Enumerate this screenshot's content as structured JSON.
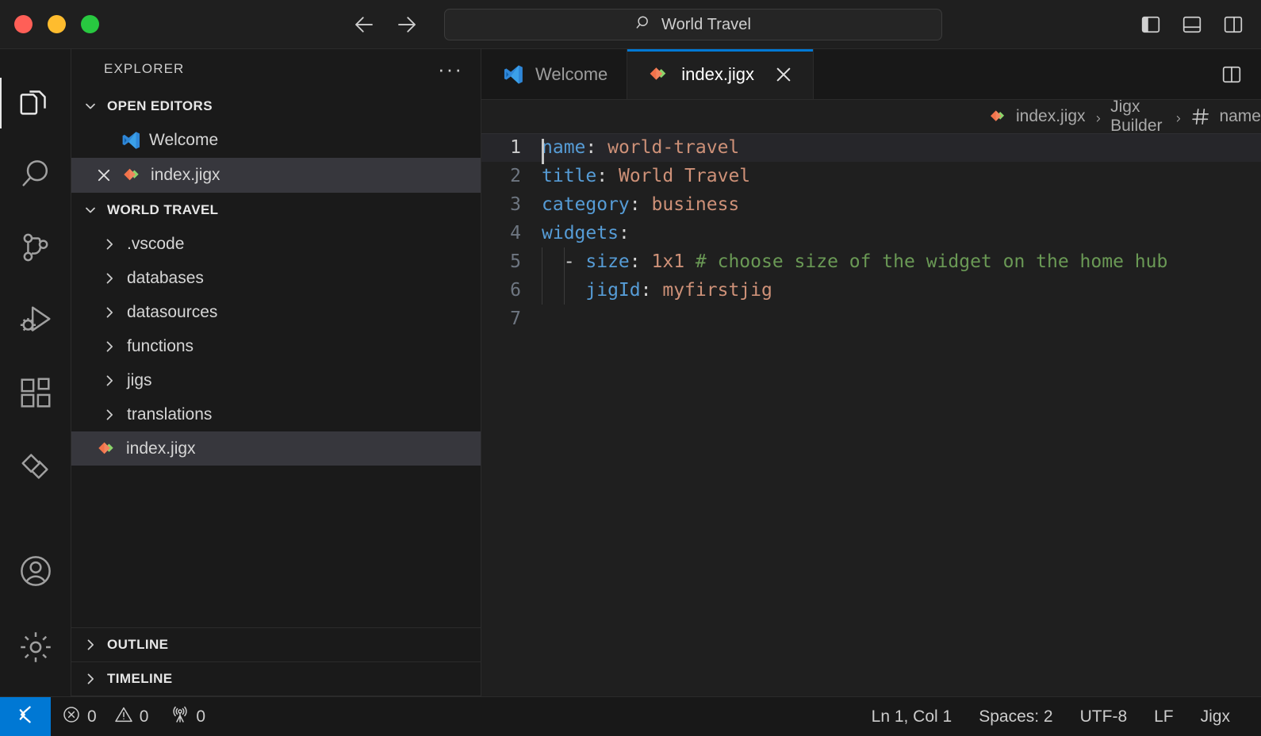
{
  "window": {
    "traffic_lights": [
      "close",
      "minimize",
      "maximize"
    ],
    "accent_blue": "#0078d4",
    "command_center": {
      "text": "World Travel",
      "icon": "search-icon"
    },
    "nav": {
      "back": "back-arrow-icon",
      "forward": "forward-arrow-icon"
    },
    "layout_toggles": [
      {
        "name": "toggle-primary-sidebar",
        "state": "on"
      },
      {
        "name": "toggle-panel",
        "state": "off"
      },
      {
        "name": "toggle-secondary-sidebar",
        "state": "off"
      }
    ]
  },
  "activity_bar": {
    "items": [
      {
        "name": "explorer",
        "icon": "files-icon",
        "active": true
      },
      {
        "name": "search",
        "icon": "search-icon",
        "active": false
      },
      {
        "name": "source-control",
        "icon": "source-control-icon",
        "active": false
      },
      {
        "name": "run-and-debug",
        "icon": "run-debug-icon",
        "active": false
      },
      {
        "name": "extensions",
        "icon": "extensions-icon",
        "active": false
      },
      {
        "name": "jigx",
        "icon": "jigx-diamond-icon",
        "active": false
      }
    ],
    "bottom_items": [
      {
        "name": "accounts",
        "icon": "account-icon"
      },
      {
        "name": "manage-settings",
        "icon": "gear-icon"
      }
    ]
  },
  "sidebar": {
    "title": "EXPLORER",
    "more_actions": "···",
    "open_editors": {
      "label": "OPEN EDITORS",
      "expanded": true,
      "items": [
        {
          "label": "Welcome",
          "icon": "vscode-logo-icon",
          "selected": false,
          "has_close": false
        },
        {
          "label": "index.jigx",
          "icon": "jigx-file-icon",
          "selected": true,
          "has_close": true
        }
      ]
    },
    "workspace": {
      "label": "WORLD TRAVEL",
      "expanded": true,
      "folders": [
        {
          "label": ".vscode",
          "type": "folder",
          "expanded": false
        },
        {
          "label": "databases",
          "type": "folder",
          "expanded": false
        },
        {
          "label": "datasources",
          "type": "folder",
          "expanded": false
        },
        {
          "label": "functions",
          "type": "folder",
          "expanded": false
        },
        {
          "label": "jigs",
          "type": "folder",
          "expanded": false
        },
        {
          "label": "translations",
          "type": "folder",
          "expanded": false
        }
      ],
      "files": [
        {
          "label": "index.jigx",
          "type": "file",
          "icon": "jigx-file-icon",
          "selected": true
        }
      ]
    },
    "outline": {
      "label": "OUTLINE",
      "expanded": false
    },
    "timeline": {
      "label": "TIMELINE",
      "expanded": false
    }
  },
  "editor": {
    "tabs": [
      {
        "label": "Welcome",
        "icon": "vscode-logo-icon",
        "active": false,
        "closable": false
      },
      {
        "label": "index.jigx",
        "icon": "jigx-file-icon",
        "active": true,
        "closable": true
      }
    ],
    "split_editor_icon": "split-editor-right-icon",
    "breadcrumbs": [
      {
        "label": "index.jigx",
        "icon": "jigx-file-icon"
      },
      {
        "label": "Jigx Builder",
        "icon": null
      },
      {
        "label": "name",
        "icon": "symbol-key-icon"
      }
    ],
    "lines": [
      {
        "number": "1",
        "current": true,
        "cursor": true,
        "tokens": [
          {
            "t": "name",
            "c": "k"
          },
          {
            "t": ":",
            "c": "p"
          },
          {
            "t": " ",
            "c": "d"
          },
          {
            "t": "world-travel",
            "c": "s"
          }
        ]
      },
      {
        "number": "2",
        "current": false,
        "cursor": false,
        "tokens": [
          {
            "t": "title",
            "c": "k"
          },
          {
            "t": ":",
            "c": "p"
          },
          {
            "t": " ",
            "c": "d"
          },
          {
            "t": "World Travel",
            "c": "s"
          }
        ]
      },
      {
        "number": "3",
        "current": false,
        "cursor": false,
        "tokens": [
          {
            "t": "category",
            "c": "k"
          },
          {
            "t": ":",
            "c": "p"
          },
          {
            "t": " ",
            "c": "d"
          },
          {
            "t": "business",
            "c": "s"
          }
        ]
      },
      {
        "number": "4",
        "current": false,
        "cursor": false,
        "tokens": [
          {
            "t": "widgets",
            "c": "k"
          },
          {
            "t": ":",
            "c": "p"
          }
        ]
      },
      {
        "number": "5",
        "current": false,
        "cursor": false,
        "guides": [
          0,
          1
        ],
        "tokens": [
          {
            "t": "  - ",
            "c": "d"
          },
          {
            "t": "size",
            "c": "k"
          },
          {
            "t": ":",
            "c": "p"
          },
          {
            "t": " ",
            "c": "d"
          },
          {
            "t": "1x1",
            "c": "s"
          },
          {
            "t": " ",
            "c": "d"
          },
          {
            "t": "# choose size of the widget on the home hub",
            "c": "c"
          }
        ]
      },
      {
        "number": "6",
        "current": false,
        "cursor": false,
        "guides": [
          0,
          1
        ],
        "tokens": [
          {
            "t": "    ",
            "c": "d"
          },
          {
            "t": "jigId",
            "c": "k"
          },
          {
            "t": ":",
            "c": "p"
          },
          {
            "t": " ",
            "c": "d"
          },
          {
            "t": "myfirstjig",
            "c": "s"
          }
        ]
      },
      {
        "number": "7",
        "current": false,
        "cursor": false,
        "tokens": []
      }
    ]
  },
  "status_bar": {
    "remote_icon": "remote-window-icon",
    "left": [
      {
        "name": "errors",
        "icon": "error-circle-icon",
        "value": "0"
      },
      {
        "name": "warnings",
        "icon": "warning-triangle-icon",
        "value": "0"
      },
      {
        "name": "ports",
        "icon": "radio-tower-icon",
        "value": "0"
      }
    ],
    "right": [
      {
        "name": "cursor-position",
        "value": "Ln 1, Col 1"
      },
      {
        "name": "indentation",
        "value": "Spaces: 2"
      },
      {
        "name": "encoding",
        "value": "UTF-8"
      },
      {
        "name": "eol",
        "value": "LF"
      },
      {
        "name": "language-mode",
        "value": "Jigx"
      }
    ]
  }
}
